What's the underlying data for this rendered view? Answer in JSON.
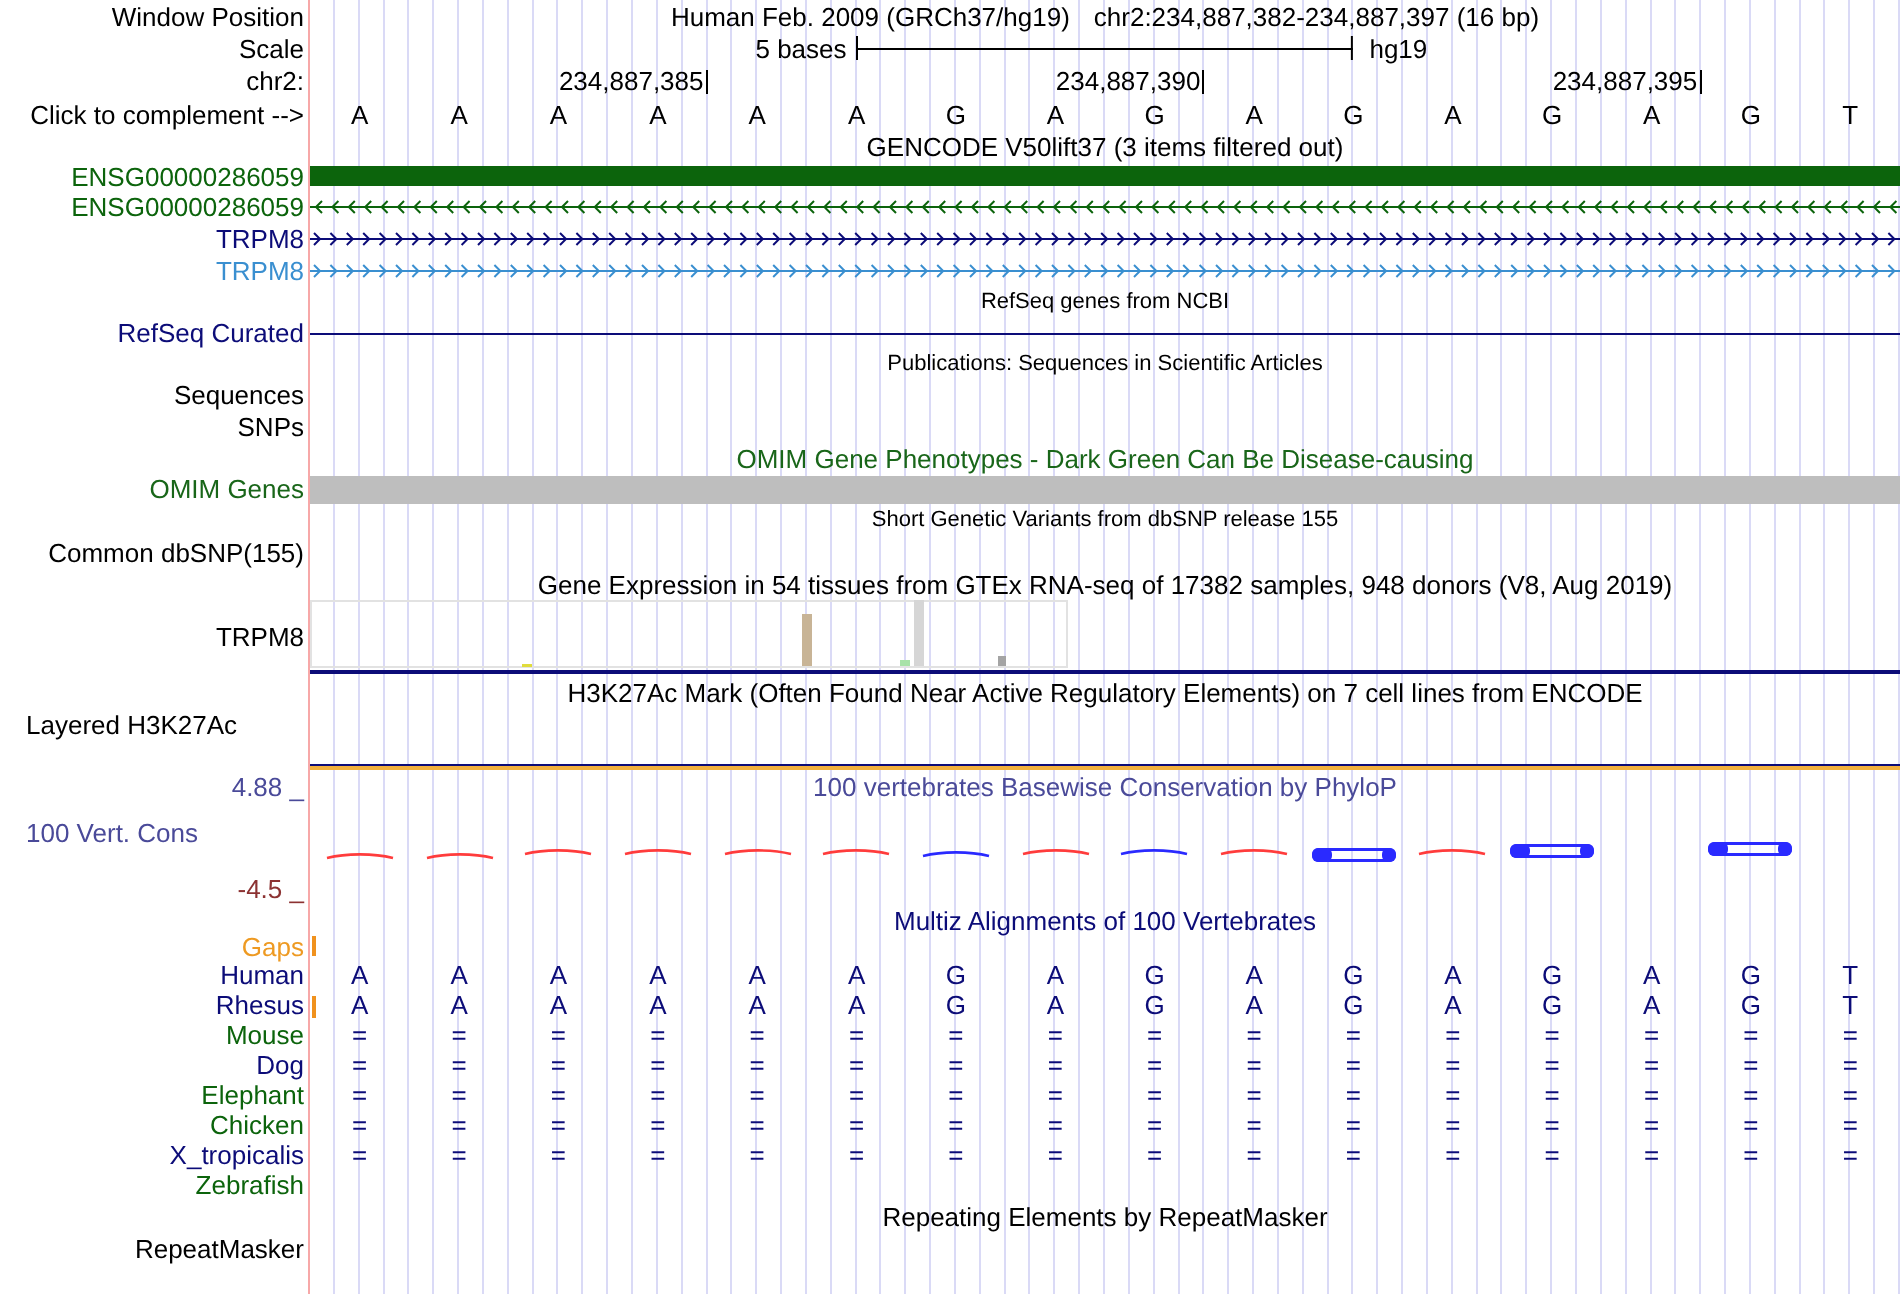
{
  "ruler": {
    "window_position": {
      "label": "Window Position",
      "assembly": "Human Feb. 2009 (GRCh37/hg19)",
      "range": "chr2:234,887,382-234,887,397 (16 bp)"
    },
    "scale": {
      "label": "Scale",
      "span": "5 bases",
      "assembly": "hg19"
    },
    "coordinates": {
      "label": "chr2:",
      "ticks": [
        "234,887,385",
        "234,887,390",
        "234,887,395"
      ]
    },
    "sequence": {
      "label": "Click to complement -->",
      "bases": [
        "A",
        "A",
        "A",
        "A",
        "A",
        "A",
        "G",
        "A",
        "G",
        "A",
        "G",
        "A",
        "G",
        "A",
        "G",
        "T"
      ]
    }
  },
  "tracks": [
    {
      "kind": "genes",
      "title": "GENCODE V50lift37 (3 items filtered out)",
      "items": [
        {
          "label": "ENSG00000286059",
          "kind": "block",
          "color": "#0c640c"
        },
        {
          "label": "ENSG00000286059",
          "kind": "arrows",
          "reverse": true,
          "color": "#0c640c"
        },
        {
          "label": "TRPM8",
          "kind": "arrows",
          "reverse": false,
          "color": "#0c0c78"
        },
        {
          "label": "TRPM8",
          "kind": "arrows",
          "reverse": false,
          "color": "#3a8fd0"
        }
      ]
    },
    {
      "kind": "refseq",
      "title": "RefSeq genes from NCBI",
      "items": [
        {
          "label": "RefSeq Curated",
          "kind": "line",
          "color": "#0c0c78"
        }
      ]
    },
    {
      "kind": "publications",
      "title": "Publications: Sequences in Scientific Articles",
      "labels": [
        "Sequences",
        "SNPs"
      ]
    },
    {
      "kind": "omim",
      "title": "OMIM Gene Phenotypes - Dark Green Can Be Disease-causing",
      "color": "#196619",
      "label": "OMIM Genes"
    },
    {
      "kind": "dbsnp",
      "title": "Short Genetic Variants from dbSNP release 155",
      "label": "Common dbSNP(155)"
    },
    {
      "kind": "expression",
      "title": "Gene Expression in 54 tissues from GTEx RNA-seq of 17382 samples, 948 donors (V8, Aug 2019)",
      "label": "TRPM8"
    },
    {
      "kind": "h3k27ac",
      "title": "H3K27Ac Mark (Often Found Near Active Regulatory Elements) on 7 cell lines from ENCODE",
      "label": "Layered H3K27Ac"
    },
    {
      "kind": "conservation",
      "title": "100 vertebrates Basewise Conservation by PhyloP",
      "color": "#4a4a99",
      "label": "100 Vert. Cons",
      "max": {
        "text": "4.88 _",
        "color": "#4a4a99"
      },
      "min": {
        "text": "-4.5 _",
        "color": "#8c3232"
      }
    },
    {
      "kind": "multiz",
      "title": "Multiz Alignments of 100 Vertebrates",
      "color": "#0c0c78",
      "gaps": {
        "label": "Gaps",
        "color": "#ee9a22",
        "insertion": true
      },
      "species": [
        {
          "name": "Human",
          "color": "#0c0c78",
          "insertion": false,
          "bases": [
            "A",
            "A",
            "A",
            "A",
            "A",
            "A",
            "G",
            "A",
            "G",
            "A",
            "G",
            "A",
            "G",
            "A",
            "G",
            "T"
          ]
        },
        {
          "name": "Rhesus",
          "color": "#0c0c78",
          "insertion": true,
          "bases": [
            "A",
            "A",
            "A",
            "A",
            "A",
            "A",
            "G",
            "A",
            "G",
            "A",
            "G",
            "A",
            "G",
            "A",
            "G",
            "T"
          ]
        },
        {
          "name": "Mouse",
          "color": "#0c640c",
          "insertion": false,
          "bases": [
            "=",
            "=",
            "=",
            "=",
            "=",
            "=",
            "=",
            "=",
            "=",
            "=",
            "=",
            "=",
            "=",
            "=",
            "=",
            "="
          ]
        },
        {
          "name": "Dog",
          "color": "#0c0c78",
          "insertion": false,
          "bases": [
            "=",
            "=",
            "=",
            "=",
            "=",
            "=",
            "=",
            "=",
            "=",
            "=",
            "=",
            "=",
            "=",
            "=",
            "=",
            "="
          ]
        },
        {
          "name": "Elephant",
          "color": "#0c640c",
          "insertion": false,
          "bases": [
            "=",
            "=",
            "=",
            "=",
            "=",
            "=",
            "=",
            "=",
            "=",
            "=",
            "=",
            "=",
            "=",
            "=",
            "=",
            "="
          ]
        },
        {
          "name": "Chicken",
          "color": "#0c640c",
          "insertion": false,
          "bases": [
            "=",
            "=",
            "=",
            "=",
            "=",
            "=",
            "=",
            "=",
            "=",
            "=",
            "=",
            "=",
            "=",
            "=",
            "=",
            "="
          ]
        },
        {
          "name": "X_tropicalis",
          "color": "#0c0c78",
          "insertion": false,
          "bases": [
            "=",
            "=",
            "=",
            "=",
            "=",
            "=",
            "=",
            "=",
            "=",
            "=",
            "=",
            "=",
            "=",
            "=",
            "=",
            "="
          ]
        },
        {
          "name": "Zebrafish",
          "color": "#0c640c",
          "insertion": false
        }
      ]
    },
    {
      "kind": "repeats",
      "title": "Repeating Elements by RepeatMasker",
      "label": "RepeatMasker"
    }
  ]
}
